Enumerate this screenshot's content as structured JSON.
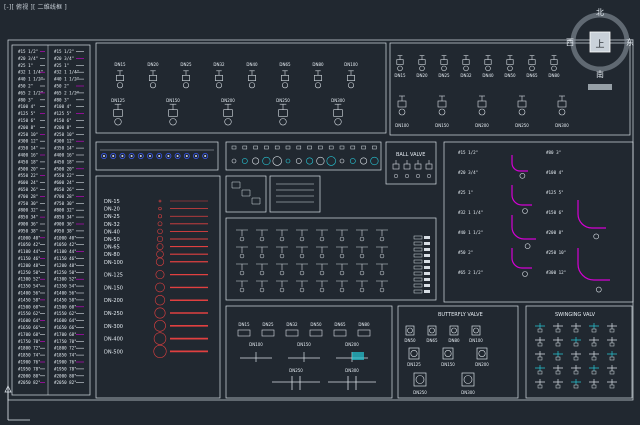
{
  "header": {
    "view": "[-][俯视][二维线框]",
    "seg1": "俯视",
    "seg2": "二维线框"
  },
  "viewcube": {
    "north": "北",
    "south": "南",
    "east": "东",
    "west": "西",
    "top_face": "上"
  },
  "pipe_table": {
    "left_labels": [
      "#15 1/2\"",
      "#20 3/4\"",
      "#25 1\"",
      "#32 1 1/4\"",
      "#40 1 1/2\"",
      "#50 2\"",
      "#65 2 1/2\"",
      "#80 3\"",
      "#100 4\"",
      "#125 5\"",
      "#150 6\"",
      "#200 8\"",
      "#250 10\"",
      "#300 12\"",
      "#350 14\"",
      "#400 16\"",
      "#450 18\"",
      "#500 20\"",
      "#550 22\"",
      "#600 24\"",
      "#650 26\"",
      "#700 28\"",
      "#750 30\"",
      "#800 32\"",
      "#850 34\"",
      "#900 36\"",
      "#950 38\"",
      "#1000 40\"",
      "#1050 42\"",
      "#1100 44\"",
      "#1150 46\"",
      "#1200 48\"",
      "#1250 50\"",
      "#1300 52\"",
      "#1350 54\"",
      "#1400 56\"",
      "#1450 58\"",
      "#1500 60\"",
      "#1550 62\"",
      "#1600 64\"",
      "#1650 66\"",
      "#1700 68\"",
      "#1750 70\"",
      "#1800 72\"",
      "#1850 74\"",
      "#1900 76\"",
      "#1950 78\"",
      "#2000 80\"",
      "#2050 82\""
    ],
    "right_labels": [
      "#15 1/2\"",
      "#20 3/4\"",
      "#25 1\"",
      "#32 1 1/4\"",
      "#40 1 1/2\"",
      "#50 2\"",
      "#65 2 1/2\"",
      "#80 3\"",
      "#100 4\"",
      "#125 5\"",
      "#150 6\"",
      "#200 8\"",
      "#250 10\"",
      "#300 12\"",
      "#350 14\"",
      "#400 16\"",
      "#450 18\"",
      "#500 20\"",
      "#550 22\"",
      "#600 24\"",
      "#650 26\"",
      "#700 28\"",
      "#750 30\"",
      "#800 32\"",
      "#850 34\"",
      "#900 36\"",
      "#950 38\"",
      "#1000 40\"",
      "#1050 42\"",
      "#1100 44\"",
      "#1150 46\"",
      "#1200 48\"",
      "#1250 50\"",
      "#1300 52\"",
      "#1350 54\"",
      "#1400 56\"",
      "#1450 58\"",
      "#1500 60\"",
      "#1550 62\"",
      "#1600 64\"",
      "#1650 66\"",
      "#1700 68\"",
      "#1750 70\"",
      "#1800 72\"",
      "#1850 74\"",
      "#1900 76\"",
      "#1950 78\"",
      "#2000 80\"",
      "#2050 82\""
    ]
  },
  "valves_top": {
    "row1": [
      "DN15",
      "DN20",
      "DN25",
      "DN32",
      "DN40",
      "DN65",
      "DN80",
      "DN100"
    ],
    "row2": [
      "DN125",
      "DN150",
      "DN200",
      "DN250",
      "DN300"
    ]
  },
  "valves_right": {
    "row1": [
      "DN15",
      "DN20",
      "DN25",
      "DN32",
      "DN40",
      "DN50",
      "DN65",
      "DN80"
    ],
    "row2": [
      "DN100",
      "DN150",
      "DN200",
      "DN250",
      "DN300"
    ]
  },
  "dn_list": [
    "DN-15",
    "DN-20",
    "DN-25",
    "DN-32",
    "DN-40",
    "DN-50",
    "DN-65",
    "DN-80",
    "DN-100",
    "DN-125",
    "DN-150",
    "DN-200",
    "DN-250",
    "DN-300",
    "DN-400",
    "DN-500"
  ],
  "ball_valve": {
    "title": "BALL VALVE"
  },
  "elbow_labels": [
    "#15 1/2\"",
    "#20 3/4\"",
    "#25 1\"",
    "#32 1 1/4\"",
    "#40 1 1/2\"",
    "#50 2\"",
    "#65 2 1/2\"",
    "#80 3\"",
    "#100 4\"",
    "#125 5\"",
    "#150 6\"",
    "#200 8\"",
    "#250 10\"",
    "#300 12\""
  ],
  "fittings_bottom": {
    "row1": [
      "DN15",
      "DN25",
      "DN32",
      "DN50",
      "DN65",
      "DN80"
    ],
    "row2": [
      "DN100",
      "DN150",
      "DN200"
    ],
    "row3": [
      "DN250",
      "DN300"
    ]
  },
  "butterfly": {
    "title": "BUTTERFLY VALVE",
    "row1": [
      "DN50",
      "DN65",
      "DN80",
      "DN100"
    ],
    "row2": [
      "DN125",
      "DN150",
      "DN200"
    ],
    "row3": [
      "DN250",
      "DN300"
    ]
  },
  "swagelok": {
    "title": "SWINGING VALV"
  },
  "colors": {
    "bg": "#212830",
    "line": "#d8dee4",
    "magenta": "#d400d4",
    "red": "#e04040",
    "blue": "#3a5cff",
    "cyan": "#27c7d6",
    "yellow": "#e6d33a"
  }
}
